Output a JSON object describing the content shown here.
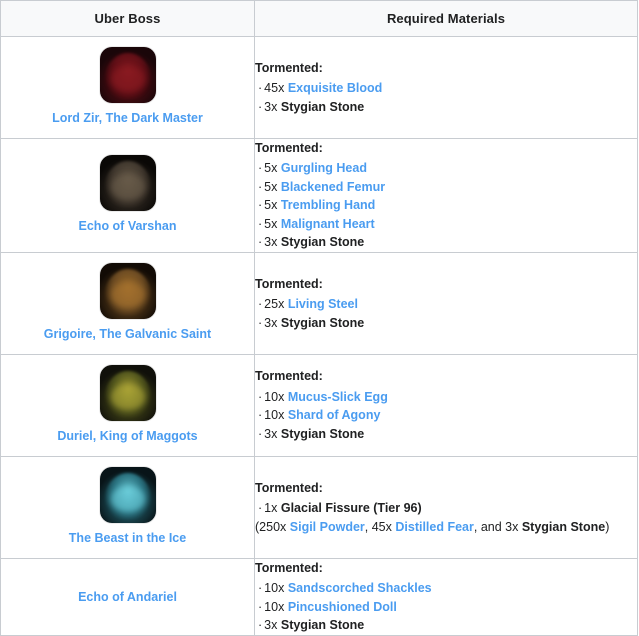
{
  "table": {
    "columns": [
      {
        "label": "Uber Boss"
      },
      {
        "label": "Required Materials"
      }
    ],
    "tier_label": "Tormented:",
    "bullet": "·",
    "link_color": "#4a9cf0",
    "text_color": "#202122",
    "header_bg": "#f8f9fa",
    "border_color": "#c8ccd1",
    "rows": [
      {
        "boss": "Lord Zir, The Dark Master",
        "thumb": {
          "name": "lord-zir-thumbnail",
          "bg": "#1a0609",
          "shape": "#6b1119",
          "glow": "#8d1c22"
        },
        "tier": "Tormented:",
        "materials": [
          {
            "qty": "45x",
            "name": "Exquisite Blood",
            "link": true
          },
          {
            "qty": "3x",
            "name": "Stygian Stone",
            "link": false
          }
        ],
        "note": null
      },
      {
        "boss": "Echo of Varshan",
        "thumb": {
          "name": "echo-of-varshan-thumbnail",
          "bg": "#0a0806",
          "shape": "#4a4035",
          "glow": "#6b5e4c"
        },
        "tier": "Tormented:",
        "materials": [
          {
            "qty": "5x",
            "name": "Gurgling Head",
            "link": true
          },
          {
            "qty": "5x",
            "name": "Blackened Femur",
            "link": true
          },
          {
            "qty": "5x",
            "name": "Trembling Hand",
            "link": true
          },
          {
            "qty": "5x",
            "name": "Malignant Heart",
            "link": true
          },
          {
            "qty": "3x",
            "name": "Stygian Stone",
            "link": false
          }
        ],
        "note": null
      },
      {
        "boss": "Grigoire, The Galvanic Saint",
        "thumb": {
          "name": "grigoire-thumbnail",
          "bg": "#120b05",
          "shape": "#7a5527",
          "glow": "#a8742f"
        },
        "tier": "Tormented:",
        "materials": [
          {
            "qty": "25x",
            "name": "Living Steel",
            "link": true
          },
          {
            "qty": "3x",
            "name": "Stygian Stone",
            "link": false
          }
        ],
        "note": null
      },
      {
        "boss": "Duriel, King of Maggots",
        "thumb": {
          "name": "duriel-thumbnail",
          "bg": "#10100a",
          "shape": "#5c6020",
          "glow": "#b0a838"
        },
        "tier": "Tormented:",
        "materials": [
          {
            "qty": "10x",
            "name": "Mucus-Slick Egg",
            "link": true
          },
          {
            "qty": "10x",
            "name": "Shard of Agony",
            "link": true
          },
          {
            "qty": "3x",
            "name": "Stygian Stone",
            "link": false
          }
        ],
        "note": null
      },
      {
        "boss": "The Beast in the Ice",
        "thumb": {
          "name": "beast-in-the-ice-thumbnail",
          "bg": "#081418",
          "shape": "#2e7d8c",
          "glow": "#6fd3e0"
        },
        "tier": "Tormented:",
        "materials": [
          {
            "qty": "1x",
            "name": "Glacial Fissure (Tier 96)",
            "link": false
          }
        ],
        "note": {
          "open": "(",
          "parts": [
            {
              "qty": "250x",
              "name": "Sigil Powder",
              "link": true,
              "sep": ", "
            },
            {
              "qty": "45x",
              "name": "Distilled Fear",
              "link": true,
              "sep": ", and "
            },
            {
              "qty": "3x",
              "name": "Stygian Stone",
              "link": false,
              "sep": ""
            }
          ],
          "close": ")"
        }
      },
      {
        "boss": "Echo of Andariel",
        "thumb": null,
        "tier": "Tormented:",
        "materials": [
          {
            "qty": "10x",
            "name": "Sandscorched Shackles",
            "link": true
          },
          {
            "qty": "10x",
            "name": "Pincushioned Doll",
            "link": true
          },
          {
            "qty": "3x",
            "name": "Stygian Stone",
            "link": false
          }
        ],
        "note": null
      }
    ]
  }
}
